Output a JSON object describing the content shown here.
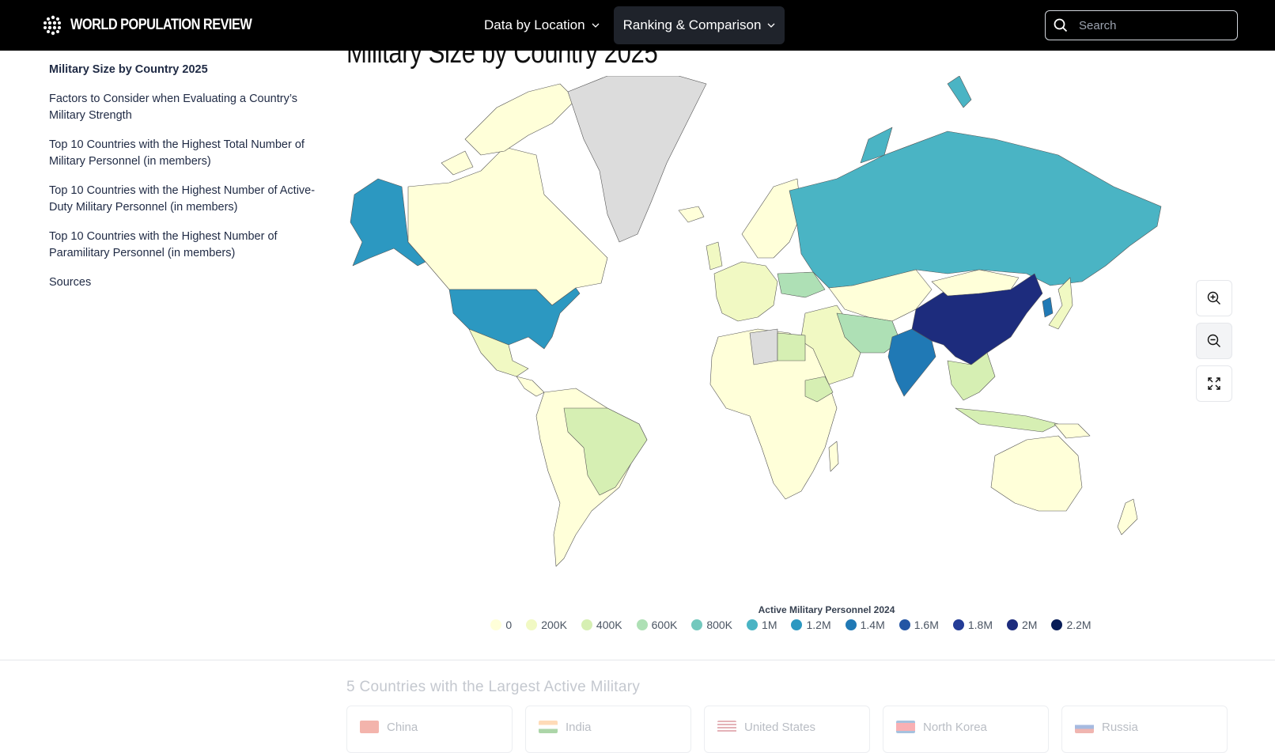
{
  "header": {
    "brand": "WORLD POPULATION REVIEW",
    "nav": [
      {
        "label": "Data by Location"
      },
      {
        "label": "Ranking & Comparison"
      }
    ],
    "search_placeholder": "Search"
  },
  "sidebar": {
    "items": [
      {
        "label": "Military Size by Country 2025"
      },
      {
        "label": "Factors to Consider when Evaluating a Country’s Military Strength"
      },
      {
        "label": "Top 10 Countries with the Highest Total Number of Military Personnel (in members)"
      },
      {
        "label": "Top 10 Countries with the Highest Number of Active-Duty Military Personnel (in members)"
      },
      {
        "label": "Top 10 Countries with the Highest Number of Paramilitary Personnel (in members)"
      },
      {
        "label": "Sources"
      }
    ]
  },
  "main": {
    "title": "Military Size by Country 2025",
    "legend": {
      "title": "Active Military Personnel 2024",
      "items": [
        {
          "label": "0",
          "color": "#ffffd9"
        },
        {
          "label": "200K",
          "color": "#f1f9c3"
        },
        {
          "label": "400K",
          "color": "#d6efb3"
        },
        {
          "label": "600K",
          "color": "#aee0b5"
        },
        {
          "label": "800K",
          "color": "#73c8bd"
        },
        {
          "label": "1M",
          "color": "#4ab4c4"
        },
        {
          "label": "1.2M",
          "color": "#2c98c1"
        },
        {
          "label": "1.4M",
          "color": "#2079b5"
        },
        {
          "label": "1.6M",
          "color": "#2355a4"
        },
        {
          "label": "1.8M",
          "color": "#243c97"
        },
        {
          "label": "2M",
          "color": "#1d2c7d"
        },
        {
          "label": "2.2M",
          "color": "#081d58"
        }
      ]
    },
    "no_data_color": "#dcdcdc",
    "section_title": "5 Countries with the Largest Active Military",
    "cards": [
      {
        "country": "China"
      },
      {
        "country": "India"
      },
      {
        "country": "United States"
      },
      {
        "country": "North Korea"
      },
      {
        "country": "Russia"
      }
    ]
  }
}
